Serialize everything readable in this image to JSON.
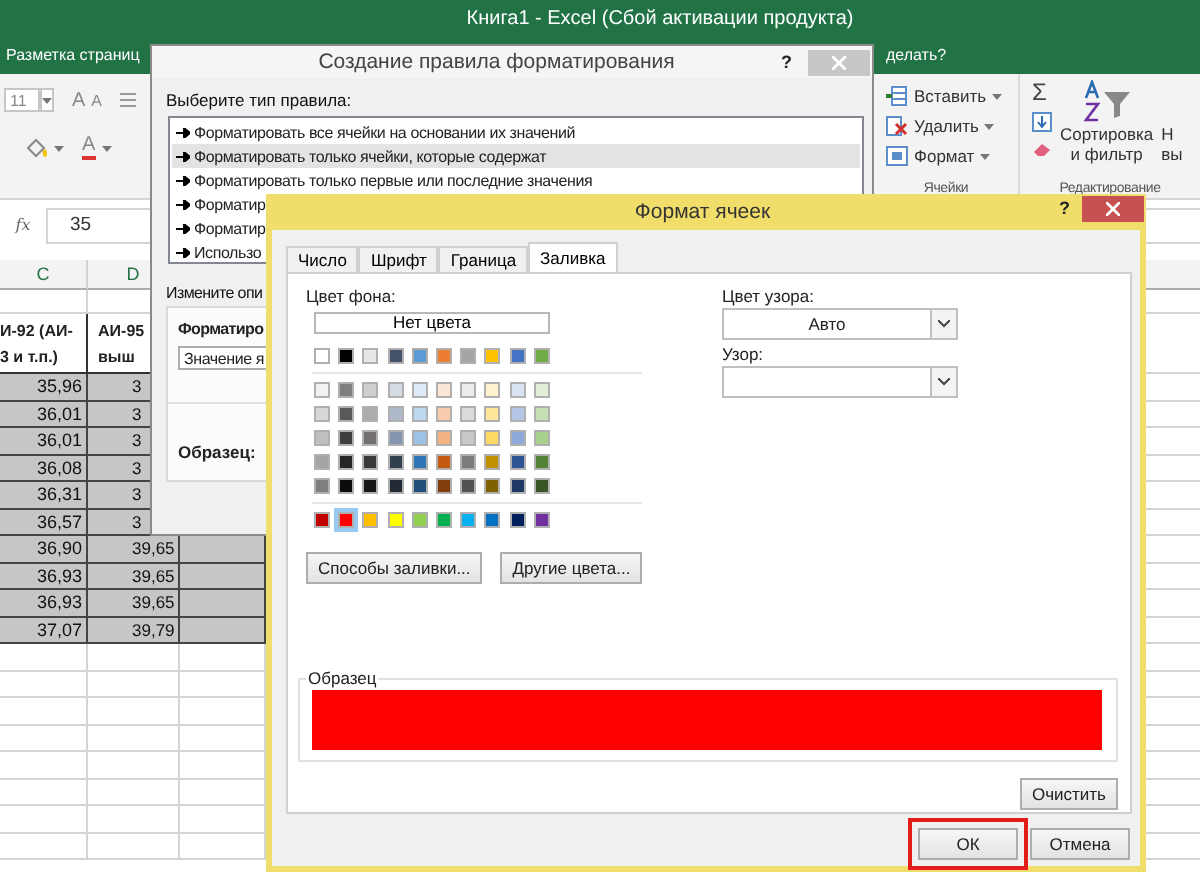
{
  "excel": {
    "title": "Книга1 - Excel (Сбой активации продукта)",
    "ribbon_tab": "Разметка страниц",
    "tell_me": "делать?",
    "font": {
      "size": "11",
      "grow": "A",
      "shrink": "A",
      "color_letter": "A"
    },
    "cells_group": {
      "label": "Ячейки",
      "buttons": [
        {
          "label": "Вставить",
          "kind": "insert"
        },
        {
          "label": "Удалить",
          "kind": "delete"
        },
        {
          "label": "Формат",
          "kind": "format"
        }
      ]
    },
    "editing_group": {
      "label": "Редактирование",
      "sum": "Σ",
      "sort": "Сортировка",
      "sort_2": "и фильтр",
      "find": "Н",
      "find_2": "вы"
    },
    "formula_bar": {
      "fx": "fx",
      "value": "35"
    },
    "columns": [
      "C",
      "D"
    ],
    "header_cells": [
      [
        "И-92 (АИ-",
        "3 и т.п.)"
      ],
      [
        "АИ-95",
        "выш"
      ]
    ],
    "rows": [
      {
        "c": "35,96",
        "d": "3",
        "selected": true
      },
      {
        "c": "36,01",
        "d": "3",
        "selected": true
      },
      {
        "c": "36,01",
        "d": "3",
        "selected": true
      },
      {
        "c": "36,08",
        "d": "3",
        "selected": true
      },
      {
        "c": "36,31",
        "d": "3",
        "selected": true
      },
      {
        "c": "36,57",
        "d": "3",
        "selected": true
      },
      {
        "c": "36,90",
        "d": "39,65",
        "selected": true
      },
      {
        "c": "36,93",
        "d": "39,65",
        "selected": true
      },
      {
        "c": "36,93",
        "d": "39,65",
        "selected": true
      },
      {
        "c": "37,07",
        "d": "39,79",
        "selected": true
      }
    ]
  },
  "rule_dialog": {
    "title": "Создание правила форматирования",
    "help": "?",
    "rule_type_label": "Выберите тип правила:",
    "rule_types": [
      {
        "label": "Форматировать все ячейки на основании их значений",
        "selected": false
      },
      {
        "label": "Форматировать только ячейки, которые содержат",
        "selected": true
      },
      {
        "label": "Форматировать только первые или последние значения",
        "selected": false
      },
      {
        "label": "Форматир",
        "selected": false
      },
      {
        "label": "Форматир",
        "selected": false
      },
      {
        "label": "Использо",
        "selected": false
      }
    ],
    "edit_label": "Измените опи",
    "format_label": "Форматиро",
    "condition_value": "Значение я",
    "preview_label": "Образец:"
  },
  "format_dialog": {
    "title": "Формат ячеек",
    "help": "?",
    "tabs": [
      {
        "label": "Число",
        "selected": false
      },
      {
        "label": "Шрифт",
        "selected": false
      },
      {
        "label": "Граница",
        "selected": false
      },
      {
        "label": "Заливка",
        "selected": true
      }
    ],
    "bg_label": "Цвет фона:",
    "no_color": "Нет цвета",
    "theme_colors": [
      {
        "color": "#ffffff",
        "selected": false
      },
      {
        "color": "#000000",
        "selected": false
      },
      {
        "color": "#e7e6e6",
        "selected": false
      },
      {
        "color": "#44546a",
        "selected": false
      },
      {
        "color": "#5b9bd5",
        "selected": false
      },
      {
        "color": "#ed7d31",
        "selected": false
      },
      {
        "color": "#a5a5a5",
        "selected": false
      },
      {
        "color": "#ffc000",
        "selected": false
      },
      {
        "color": "#4472c4",
        "selected": false
      },
      {
        "color": "#70ad47",
        "selected": false
      }
    ],
    "tints": [
      [
        {
          "color": "#f2f2f2",
          "selected": false
        },
        {
          "color": "#7f7f7f",
          "selected": false
        },
        {
          "color": "#d0cece",
          "selected": false
        },
        {
          "color": "#d6dce4",
          "selected": false
        },
        {
          "color": "#deebf6",
          "selected": false
        },
        {
          "color": "#fbe5d5",
          "selected": false
        },
        {
          "color": "#ededed",
          "selected": false
        },
        {
          "color": "#fff2cc",
          "selected": false
        },
        {
          "color": "#dae3f3",
          "selected": false
        },
        {
          "color": "#e2efd9",
          "selected": false
        }
      ],
      [
        {
          "color": "#d8d8d8",
          "selected": false
        },
        {
          "color": "#595959",
          "selected": false
        },
        {
          "color": "#aeabab",
          "selected": false
        },
        {
          "color": "#adb9ca",
          "selected": false
        },
        {
          "color": "#bdd7ee",
          "selected": false
        },
        {
          "color": "#f7cbac",
          "selected": false
        },
        {
          "color": "#dbdbdb",
          "selected": false
        },
        {
          "color": "#fee599",
          "selected": false
        },
        {
          "color": "#b4c6e7",
          "selected": false
        },
        {
          "color": "#c5e0b3",
          "selected": false
        }
      ],
      [
        {
          "color": "#bfbfbf",
          "selected": false
        },
        {
          "color": "#3f3f3f",
          "selected": false
        },
        {
          "color": "#757070",
          "selected": false
        },
        {
          "color": "#8496b0",
          "selected": false
        },
        {
          "color": "#9cc3e5",
          "selected": false
        },
        {
          "color": "#f4b183",
          "selected": false
        },
        {
          "color": "#c9c9c9",
          "selected": false
        },
        {
          "color": "#ffd965",
          "selected": false
        },
        {
          "color": "#8eaadb",
          "selected": false
        },
        {
          "color": "#a8d08d",
          "selected": false
        }
      ],
      [
        {
          "color": "#a5a5a5",
          "selected": false
        },
        {
          "color": "#262626",
          "selected": false
        },
        {
          "color": "#3a3838",
          "selected": false
        },
        {
          "color": "#323f4f",
          "selected": false
        },
        {
          "color": "#2e75b5",
          "selected": false
        },
        {
          "color": "#c55a11",
          "selected": false
        },
        {
          "color": "#7b7b7b",
          "selected": false
        },
        {
          "color": "#bf9000",
          "selected": false
        },
        {
          "color": "#2f5496",
          "selected": false
        },
        {
          "color": "#538135",
          "selected": false
        }
      ],
      [
        {
          "color": "#7f7f7f",
          "selected": false
        },
        {
          "color": "#0c0c0c",
          "selected": false
        },
        {
          "color": "#171616",
          "selected": false
        },
        {
          "color": "#222a35",
          "selected": false
        },
        {
          "color": "#1e4e79",
          "selected": false
        },
        {
          "color": "#833c0b",
          "selected": false
        },
        {
          "color": "#525252",
          "selected": false
        },
        {
          "color": "#7f6000",
          "selected": false
        },
        {
          "color": "#1f3864",
          "selected": false
        },
        {
          "color": "#375623",
          "selected": false
        }
      ]
    ],
    "standard_colors": [
      {
        "color": "#c00000",
        "selected": false
      },
      {
        "color": "#ff0000",
        "selected": true
      },
      {
        "color": "#ffc000",
        "selected": false
      },
      {
        "color": "#ffff00",
        "selected": false
      },
      {
        "color": "#92d050",
        "selected": false
      },
      {
        "color": "#00b050",
        "selected": false
      },
      {
        "color": "#00b0f0",
        "selected": false
      },
      {
        "color": "#0070c0",
        "selected": false
      },
      {
        "color": "#002060",
        "selected": false
      },
      {
        "color": "#7030a0",
        "selected": false
      }
    ],
    "fill_effects": "Способы заливки...",
    "more_colors": "Другие цвета...",
    "pattern_color_label": "Цвет узора:",
    "pattern_color": "Авто",
    "pattern_label": "Узор:",
    "sample_label": "Образец",
    "clear": "Очистить",
    "ok": {
      "label": "ОК",
      "highlighted": true
    },
    "cancel": "Отмена"
  }
}
